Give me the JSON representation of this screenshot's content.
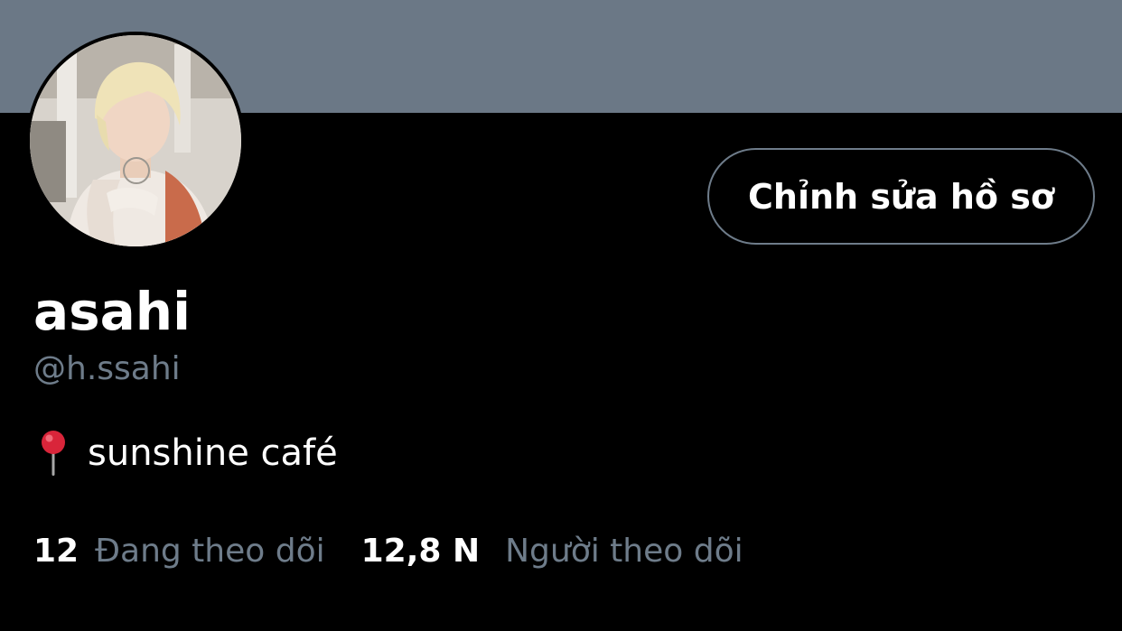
{
  "colors": {
    "banner": "#6b7886",
    "background": "#000000",
    "text_primary": "#ffffff",
    "text_secondary": "#6e7c8a",
    "button_border": "#6e7c8a"
  },
  "profile": {
    "avatar_icon": "profile-photo",
    "display_name": "asahi",
    "handle": "@h.ssahi",
    "location_icon": "round-pushpin-icon",
    "location": "sunshine café"
  },
  "actions": {
    "edit_profile_label": "Chỉnh sửa hồ sơ"
  },
  "stats": {
    "following_count": "12",
    "following_label": "Đang theo dõi",
    "followers_count": "12,8 N",
    "followers_label": "Người theo dõi"
  }
}
